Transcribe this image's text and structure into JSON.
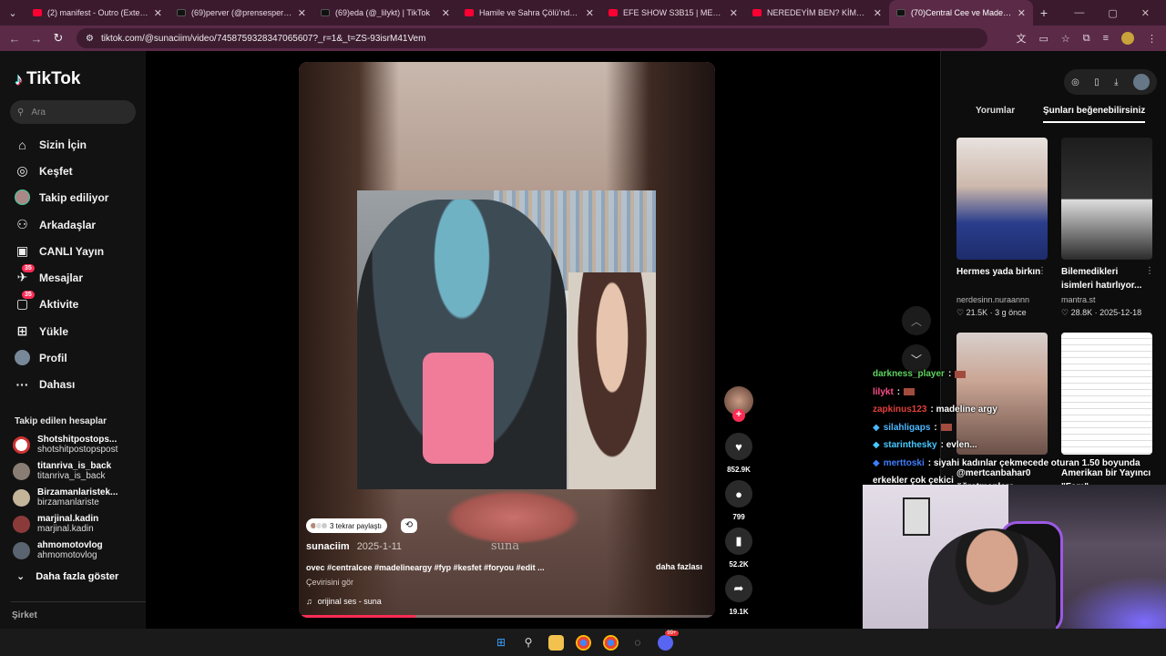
{
  "browser": {
    "tabs": [
      {
        "title": "(2) manifest - Outro (Extended)",
        "favicon": "youtube",
        "active": false
      },
      {
        "title": "(69)perver (@prensesperver) | T",
        "favicon": "tiktok",
        "active": false
      },
      {
        "title": "(69)eda (@_lilykt) | TikTok",
        "favicon": "tiktok",
        "active": false
      },
      {
        "title": "Hamile ve Sahra Çölü'nde? | M",
        "favicon": "youtube",
        "active": false
      },
      {
        "title": "EFE SHOW S3B15 | MERTCAN B",
        "favicon": "youtube",
        "active": false
      },
      {
        "title": "NEREDEYİM BEN? KİMSE YOK K",
        "favicon": "youtube",
        "active": false
      },
      {
        "title": "(70)Central Cee ve Madeline A",
        "favicon": "tiktok",
        "active": true
      }
    ],
    "url": "tiktok.com/@sunaciim/video/7458759328347065607?_r=1&_t=ZS-93isrM41Vem",
    "accent": "#5a2a47"
  },
  "sidebar": {
    "logo": "TikTok",
    "search_placeholder": "Ara",
    "nav": [
      {
        "label": "Sizin İçin",
        "icon": "home-icon",
        "active": true
      },
      {
        "label": "Keşfet",
        "icon": "compass-icon"
      },
      {
        "label": "Takip ediliyor",
        "icon": "following-avatar-icon"
      },
      {
        "label": "Arkadaşlar",
        "icon": "friends-icon"
      },
      {
        "label": "CANLI Yayın",
        "icon": "live-icon"
      },
      {
        "label": "Mesajlar",
        "icon": "messages-icon",
        "badge": "35"
      },
      {
        "label": "Aktivite",
        "icon": "activity-icon",
        "badge": "35"
      },
      {
        "label": "Yükle",
        "icon": "upload-icon"
      },
      {
        "label": "Profil",
        "icon": "profile-icon"
      },
      {
        "label": "Dahası",
        "icon": "more-icon"
      }
    ],
    "following_heading": "Takip edilen hesaplar",
    "following": [
      {
        "name": "Shotshitpostops...",
        "handle": "shotshitpostopspost"
      },
      {
        "name": "titanriva_is_back",
        "handle": "titanriva_is_back"
      },
      {
        "name": "Birzamanlaristek...",
        "handle": "birzamanlariste"
      },
      {
        "name": "marjinal.kadin",
        "handle": "marjinal.kadin"
      },
      {
        "name": "ahmomotovlog",
        "handle": "ahmomotovlog"
      }
    ],
    "show_more": "Daha fazla göster",
    "company": "Şirket"
  },
  "video": {
    "repost_label": "3 tekrar paylaştı",
    "author": "sunaciim",
    "date": "2025-1-11",
    "caption": "ovec #centralcee #madelineargy #fyp #kesfet #foryou #edit ...",
    "more_label": "daha fazlası",
    "translate_label": "Çevirisini gör",
    "sound": "orijinal ses - suna",
    "watermark": "suna",
    "progress": 0.28
  },
  "actions": {
    "likes": "852.9K",
    "comments": "799",
    "saves": "52.2K",
    "shares": "19.1K"
  },
  "right_panel": {
    "tabs": [
      "Yorumlar",
      "Şunları beğenebilirsiniz"
    ],
    "active_tab": "Şunları beğenebilirsiniz",
    "cards": [
      {
        "title": "Hermes yada birkın",
        "user": "nerdesinn.nuraannn",
        "likes": "21.5K",
        "date": "3 g önce"
      },
      {
        "title": "Bilemedikleri isimleri hatırlıyor...",
        "user": "mantra.st",
        "likes": "28.8K",
        "date": "2025-12-18"
      },
      {
        "title": "@mertcanbahar0 öğretmenlere...",
        "user": "",
        "likes": "",
        "date": ""
      },
      {
        "title": "Amerikan bir Yayıncı \"Fam\"...",
        "user": "",
        "likes": "",
        "date": ""
      }
    ]
  },
  "stream_chat": [
    {
      "user": "darkness_player",
      "color": "#5fd35f",
      "message": ":"
    },
    {
      "user": "lilykt",
      "color": "#ff4d8d",
      "message": ":"
    },
    {
      "user": "zapkinus123",
      "color": "#e0403a",
      "message": ": madeline argy"
    },
    {
      "user": "silahligaps",
      "color": "#4db8ff",
      "message": ":"
    },
    {
      "user": "starinthesky",
      "color": "#46c8ff",
      "message": ": evlen..."
    },
    {
      "user": "merttoski",
      "color": "#3f7dff",
      "message": ": siyahi kadınlar çekmecede oturan 1.50 boyunda"
    },
    {
      "user": "",
      "color": "#ffffff",
      "message": "erkekler çok çekici"
    }
  ],
  "taskbar": {
    "discord_badge": "99+"
  }
}
